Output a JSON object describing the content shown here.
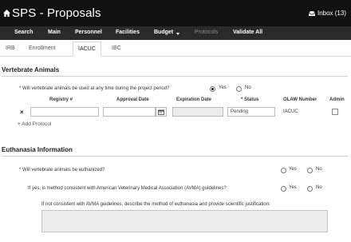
{
  "app": {
    "title": "SPS - Proposals",
    "inbox_label": "Inbox (13)"
  },
  "nav": {
    "items": [
      "Search",
      "Main",
      "Personnel",
      "Facilities",
      "Budget",
      "Protocols",
      "Validate All"
    ]
  },
  "tabs": {
    "items": [
      "IRB",
      "Enrollment",
      "IACUC",
      "IBC"
    ],
    "active": "IACUC"
  },
  "vertebrate": {
    "title": "Vertebrate Animals",
    "question": "* Will vertebrate animals be used at any time during the project period?",
    "yes": "Yes",
    "no": "No",
    "selected": "Yes",
    "table": {
      "headers": [
        "Registry #",
        "Approval Date",
        "Expiration Date",
        "* Status",
        "OLAW Number",
        "Admin"
      ],
      "row": {
        "registry": "",
        "approval_date": "",
        "expiration_date": "",
        "status": "Pending",
        "olaw_number": "IACUC",
        "admin_checked": false
      }
    },
    "add_label": "Add Protocol"
  },
  "euthanasia": {
    "title": "Euthanasia Information",
    "q1": "* Will vertebrate animals be euthanized?",
    "q2": "If yes, is method consistent with American Veterinary Medical Association (AVMA) guidelines?",
    "q3": "If not consistent with AVMA guidelines, describe the method of euthanasia and provide scientific justification:",
    "yes": "Yes",
    "no": "No"
  },
  "colors": {
    "titlebar": "#111111",
    "navbar": "#2a2a2a"
  }
}
